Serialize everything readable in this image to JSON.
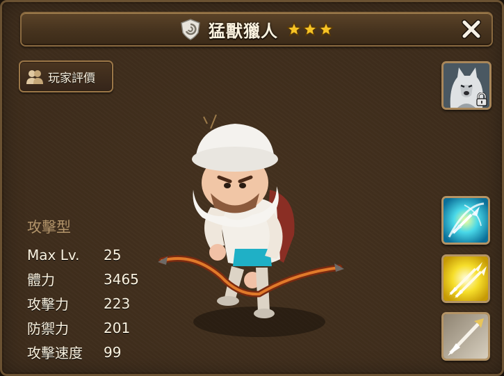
{
  "title": {
    "monster_name": "猛獸獵人",
    "star_count": 3
  },
  "buttons": {
    "player_review": "玩家評價"
  },
  "monster": {
    "type": "攻擊型",
    "stats": [
      {
        "label": "Max Lv.",
        "value": "25"
      },
      {
        "label": "體力",
        "value": "3465"
      },
      {
        "label": "攻擊力",
        "value": "223"
      },
      {
        "label": "防禦力",
        "value": "201"
      },
      {
        "label": "攻擊速度",
        "value": "99"
      }
    ]
  },
  "portrait": {
    "locked": true
  },
  "skills": [
    {
      "icon": "arrow-burst-skill-icon",
      "color": "#2fc6e8"
    },
    {
      "icon": "arrow-volley-skill-icon",
      "color": "#f2d21c"
    },
    {
      "icon": "arrow-shot-skill-icon",
      "color": "#b6aa94"
    }
  ],
  "colors": {
    "panel_bg": "#3e2d1c",
    "border_gold": "#8a6a40",
    "text_cream": "#fbf3e0",
    "type_text": "#b2946a",
    "star_gold": "#f6c325"
  }
}
